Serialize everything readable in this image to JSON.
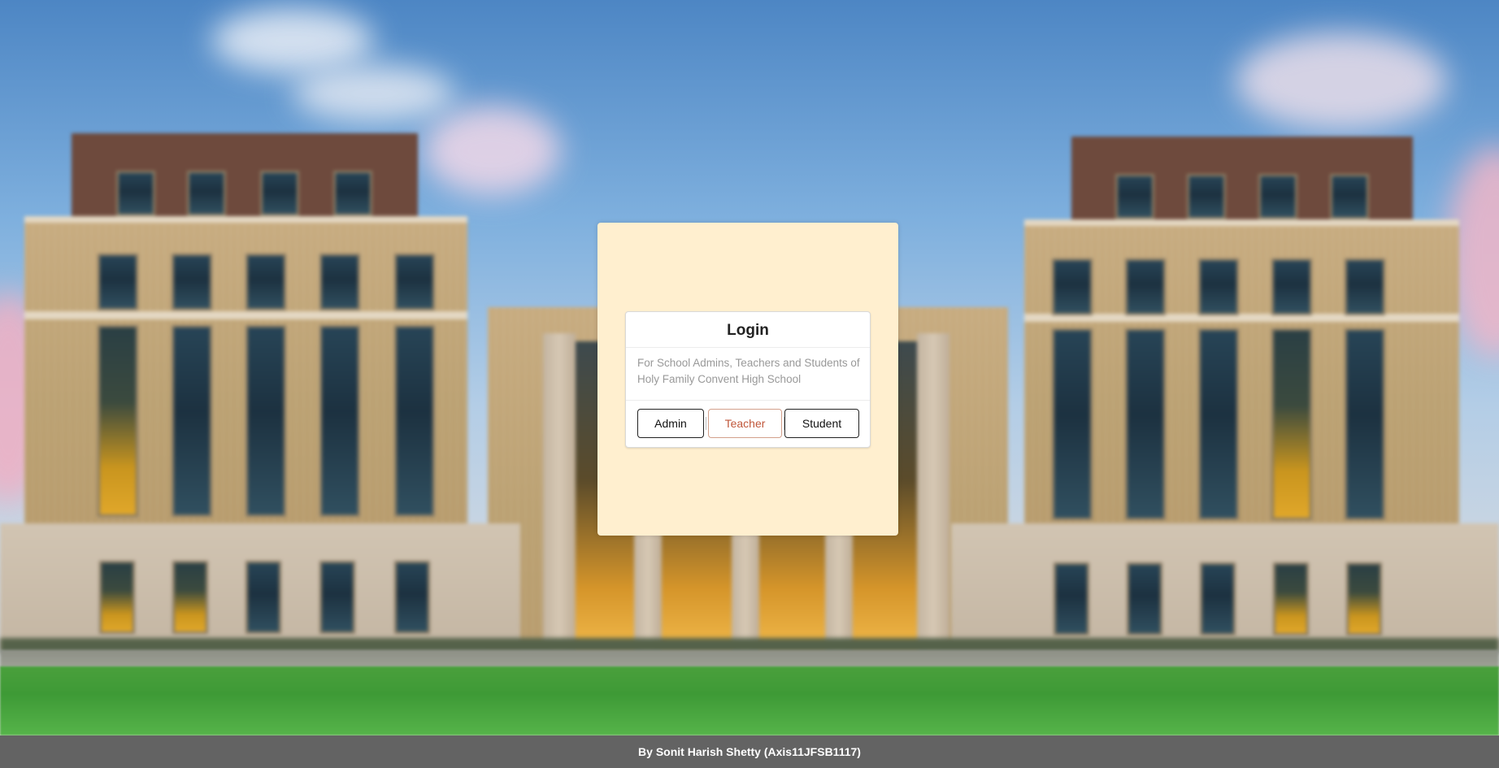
{
  "background": {
    "image": "blurred campus building photo",
    "colors": {
      "sky": "#7fb0de",
      "brick": "#c7ab7f",
      "grass": "#4aa03c"
    }
  },
  "login_panel": {
    "background": "#ffefcf"
  },
  "login_card": {
    "title": "Login",
    "description": "For School Admins, Teachers and Students of Holy Family Convent High School",
    "buttons": [
      {
        "label": "Admin",
        "selected": false
      },
      {
        "label": "Teacher",
        "selected": true
      },
      {
        "label": "Student",
        "selected": false
      }
    ],
    "active_color": "#c0573b"
  },
  "footer": {
    "text": "By Sonit Harish Shetty (Axis11JFSB1117)",
    "background": "#636363"
  }
}
